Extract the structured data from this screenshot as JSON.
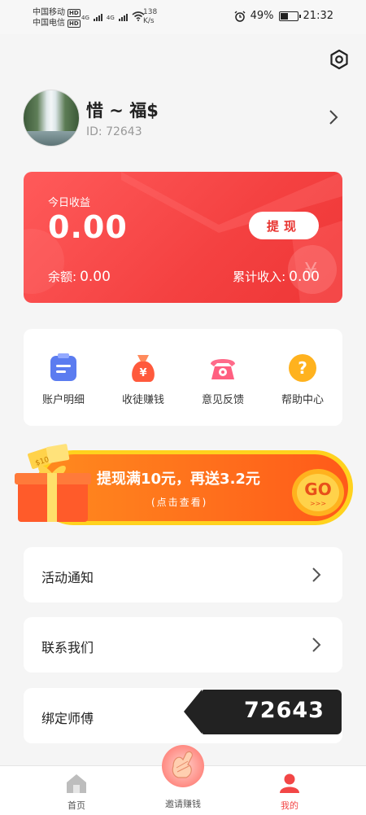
{
  "status_bar": {
    "carrier1": "中国移动",
    "carrier2": "中国电信",
    "hd": "HD",
    "net1": "4G",
    "net2": "4G",
    "speed_value": "138",
    "speed_unit": "K/s",
    "battery": "49%",
    "time": "21:32"
  },
  "profile": {
    "nickname": "惜 ~ 福$",
    "id_text": "ID: 72643"
  },
  "earnings": {
    "today_label": "今日收益",
    "today_value": "0.00",
    "withdraw_label": "提现",
    "balance_label": "余额:",
    "balance_value": "0.00",
    "total_label": "累计收入:",
    "total_value": "0.00"
  },
  "menu": [
    {
      "label": "账户明细",
      "icon": "account-detail-icon"
    },
    {
      "label": "收徒赚钱",
      "icon": "money-bag-icon"
    },
    {
      "label": "意见反馈",
      "icon": "telephone-icon"
    },
    {
      "label": "帮助中心",
      "icon": "help-icon"
    }
  ],
  "banner": {
    "title": "提现满10元，再送3.2元",
    "subtitle": "(点击查看)",
    "go": "GO",
    "go_arrows": ">>>",
    "coupon_text": "$10"
  },
  "list": [
    {
      "label": "活动通知"
    },
    {
      "label": "联系我们"
    },
    {
      "label": "绑定师傅"
    }
  ],
  "toast": {
    "text": "72643"
  },
  "tabbar": {
    "home": "首页",
    "invite": "邀请赚钱",
    "mine": "我的"
  },
  "colors": {
    "accent": "#f24646",
    "card_red": "#f44141",
    "banner_orange": "#ff7a1a",
    "banner_yellow": "#ffd21e"
  }
}
